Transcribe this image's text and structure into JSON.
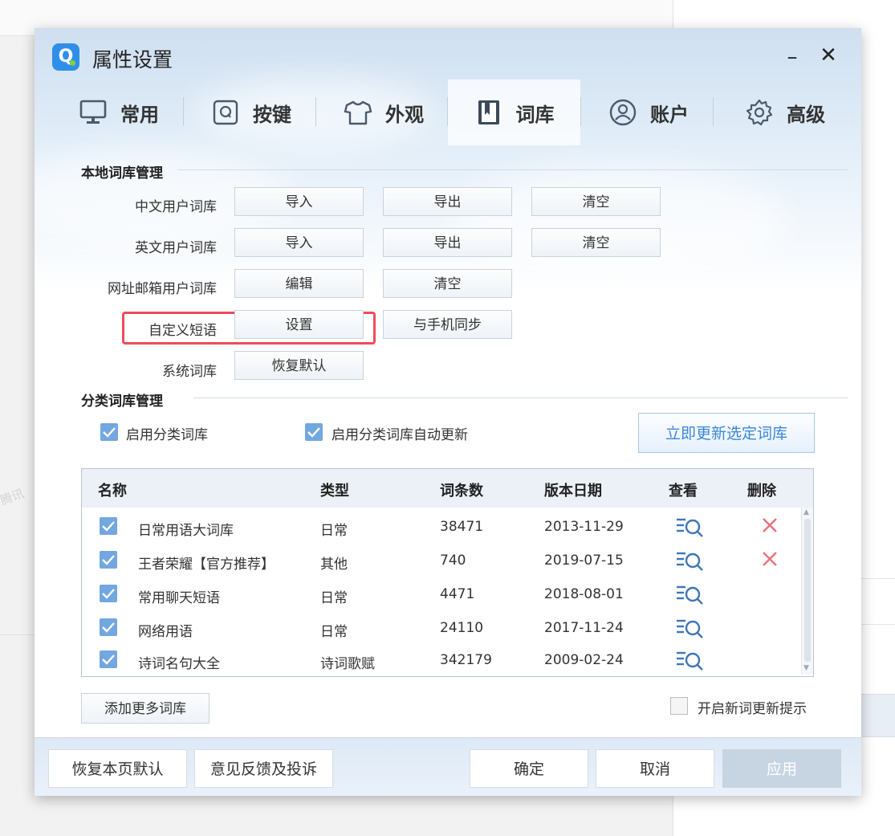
{
  "window": {
    "title": "属性设置",
    "minimize": "–",
    "close": "✕"
  },
  "background": {
    "watermark": "腾讯"
  },
  "tabs": [
    {
      "label": "常用",
      "icon": "monitor-icon"
    },
    {
      "label": "按键",
      "icon": "key-q-icon"
    },
    {
      "label": "外观",
      "icon": "shirt-icon"
    },
    {
      "label": "词库",
      "icon": "book-icon",
      "active": true
    },
    {
      "label": "账户",
      "icon": "user-icon"
    },
    {
      "label": "高级",
      "icon": "gear-icon"
    }
  ],
  "local": {
    "title": "本地词库管理",
    "rows": [
      {
        "label": "中文用户词库",
        "buttons": [
          "导入",
          "导出",
          "清空"
        ]
      },
      {
        "label": "英文用户词库",
        "buttons": [
          "导入",
          "导出",
          "清空"
        ]
      },
      {
        "label": "网址邮箱用户词库",
        "buttons": [
          "编辑",
          "清空"
        ]
      },
      {
        "label": "自定义短语",
        "buttons": [
          "设置",
          "与手机同步"
        ]
      },
      {
        "label": "系统词库",
        "buttons": [
          "恢复默认"
        ]
      }
    ]
  },
  "category": {
    "title": "分类词库管理",
    "enable_label": "启用分类词库",
    "auto_update_label": "启用分类词库自动更新",
    "update_button": "立即更新选定词库",
    "columns": [
      "名称",
      "类型",
      "词条数",
      "版本日期",
      "查看",
      "删除"
    ],
    "rows": [
      {
        "checked": true,
        "name": "日常用语大词库",
        "type": "日常",
        "count": "38471",
        "date": "2013-11-29",
        "deletable": true
      },
      {
        "checked": true,
        "name": "王者荣耀【官方推荐】",
        "type": "其他",
        "count": "740",
        "date": "2019-07-15",
        "deletable": true
      },
      {
        "checked": true,
        "name": "常用聊天短语",
        "type": "日常",
        "count": "4471",
        "date": "2018-08-01",
        "deletable": false
      },
      {
        "checked": true,
        "name": "网络用语",
        "type": "日常",
        "count": "24110",
        "date": "2017-11-24",
        "deletable": false
      },
      {
        "checked": true,
        "name": "诗词名句大全",
        "type": "诗词歌赋",
        "count": "342179",
        "date": "2009-02-24",
        "deletable": false
      }
    ],
    "add_button": "添加更多词库",
    "new_word_tip_label": "开启新词更新提示"
  },
  "footer": {
    "restore": "恢复本页默认",
    "feedback": "意见反馈及投诉",
    "ok": "确定",
    "cancel": "取消",
    "apply": "应用"
  },
  "colors": {
    "accent": "#3a87d9",
    "highlight": "#ee4c5c",
    "checkbox": "#73a7e0",
    "delete": "#e8737a"
  }
}
